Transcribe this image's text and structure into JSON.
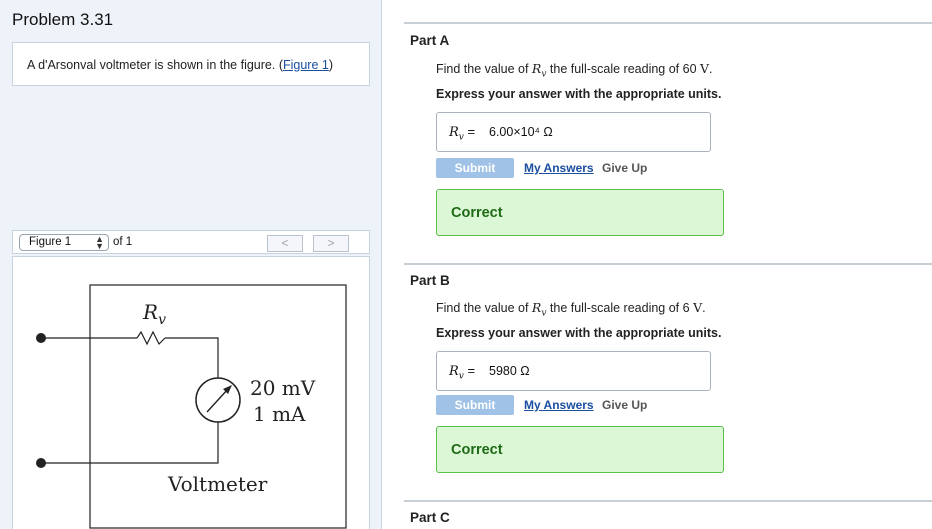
{
  "problem": {
    "title": "Problem 3.31",
    "intro_text": "A d'Arsonval voltmeter is shown in the figure. (",
    "intro_link": "Figure 1",
    "intro_end": ")"
  },
  "figure_nav": {
    "select_value": "Figure 1",
    "of_text": "of 1",
    "prev_label": "<",
    "next_label": ">"
  },
  "figure": {
    "resistor_label": "R",
    "resistor_sub": "v",
    "meter_voltage": "20 mV",
    "meter_current": "1 mA",
    "caption": "Voltmeter"
  },
  "parts": [
    {
      "title": "Part A",
      "question_prefix": "Find the value of",
      "question_var": "Rv",
      "question_mid": "the full-scale reading of 60",
      "question_unit": "V",
      "question_end": ".",
      "instructions": "Express your answer with the appropriate units.",
      "answer_lhs": "Rv =",
      "answer_value": "6.00×10⁴ Ω",
      "submit_label": "Submit",
      "my_answers_label": "My Answers",
      "give_up_label": "Give Up",
      "status": "Correct"
    },
    {
      "title": "Part B",
      "question_prefix": "Find the value of",
      "question_var": "Rv",
      "question_mid": "the full-scale reading of 6",
      "question_unit": "V",
      "question_end": ".",
      "instructions": "Express your answer with the appropriate units.",
      "answer_lhs": "Rv =",
      "answer_value": "5980 Ω",
      "submit_label": "Submit",
      "my_answers_label": "My Answers",
      "give_up_label": "Give Up",
      "status": "Correct"
    },
    {
      "title": "Part C"
    }
  ],
  "colors": {
    "panel_bg": "#eef3fa",
    "link": "#1a4fa0",
    "submit_bg": "#9fc2e6",
    "correct_bg": "#dcf7d6",
    "correct_border": "#5bbf4c",
    "correct_text": "#1e6b16"
  }
}
